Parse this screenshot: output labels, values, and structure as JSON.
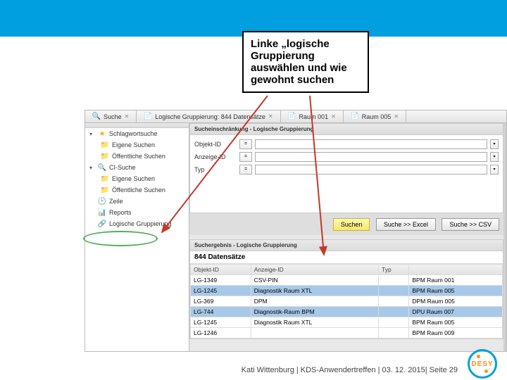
{
  "callout": "Linke „logische Gruppierung auswählen und wie gewohnt suchen",
  "tabs": [
    {
      "icon": "🔍",
      "label": "Suche"
    },
    {
      "icon": "📄",
      "label": "Logische Gruppierung: 844 Datensätze"
    },
    {
      "icon": "📄",
      "label": "Raum 001"
    },
    {
      "icon": "📄",
      "label": "Raum 005"
    }
  ],
  "sidebar": {
    "groups": [
      {
        "icon": "★",
        "label": "Schlagwortsuche",
        "items": [
          {
            "label": "Eigene Suchen"
          },
          {
            "label": "Öffentliche Suchen"
          }
        ]
      },
      {
        "icon": "🔍",
        "label": "CI-Suche",
        "items": [
          {
            "label": "Eigene Suchen"
          },
          {
            "label": "Öffentliche Suchen"
          }
        ]
      }
    ],
    "singles": [
      {
        "icon": "🕑",
        "label": "Zeile"
      },
      {
        "icon": "📊",
        "label": "Reports"
      },
      {
        "icon": "🔗",
        "label": "Logische Gruppierung"
      }
    ]
  },
  "form": {
    "header": "Sucheinschränkung - Logische Gruppierung",
    "rows": [
      {
        "label": "Objekt-ID",
        "eq": "="
      },
      {
        "label": "Anzeige-ID",
        "eq": "="
      },
      {
        "label": "Typ",
        "eq": "="
      }
    ]
  },
  "buttons": {
    "search": "Suchen",
    "add": "Suche >> Excel",
    "csv": "Suche >> CSV"
  },
  "results": {
    "header": "Suchergebnis - Logische Gruppierung",
    "count": "844 Datensätze",
    "columns": [
      "Objekt-ID",
      "Anzeige-ID",
      "Typ",
      ""
    ],
    "rows": [
      {
        "c": [
          "LG-1349",
          "CSV-PIN",
          "",
          "BPM Raum 001"
        ],
        "sel": false
      },
      {
        "c": [
          "LG-1245",
          "Diagnostik Raum XTL",
          "",
          "BPM Raum 005"
        ],
        "sel": true
      },
      {
        "c": [
          "LG-369",
          "DPM",
          "",
          "DPM Raum 005"
        ],
        "sel": false
      },
      {
        "c": [
          "LG-744",
          "Diagnostik-Raum BPM",
          "",
          "DPU Raum 007"
        ],
        "sel": true
      },
      {
        "c": [
          "LG-1245",
          "Diagnostik Raum XTL",
          "",
          "BPM Raum 005"
        ],
        "sel": false
      },
      {
        "c": [
          "LG-1246",
          "",
          "",
          "BPM Raum 009"
        ],
        "sel": false
      }
    ]
  },
  "footer": "Kati Wittenburg  |  KDS-Anwendertreffen  |  03. 12. 2015|  Seite 29",
  "logo": "DESY"
}
